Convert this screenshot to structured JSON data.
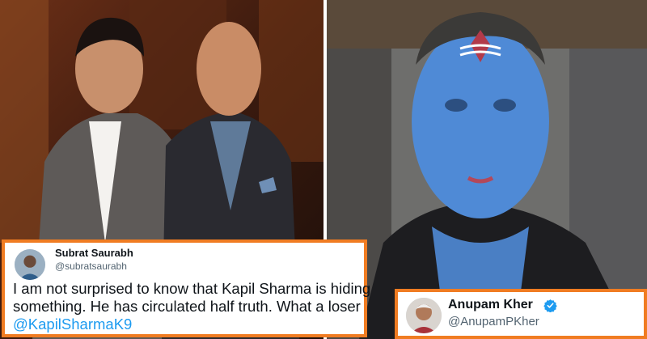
{
  "tweets": {
    "left": {
      "name": "Subrat Saurabh",
      "handle": "@subratsaurabh",
      "body_lines": [
        "I am not surprised to know that Kapil Sharma is hiding",
        "something. He has circulated half truth. What a loser"
      ],
      "mention": "@KapilSharmaK9"
    },
    "right": {
      "name": "Anupam Kher",
      "handle": "@AnupamPKher",
      "verified_icon": "verified-badge-icon"
    }
  },
  "colors": {
    "card_border": "#f07c22",
    "mention": "#1d9bf0",
    "verified": "#1d9bf0",
    "handle": "#536471"
  }
}
